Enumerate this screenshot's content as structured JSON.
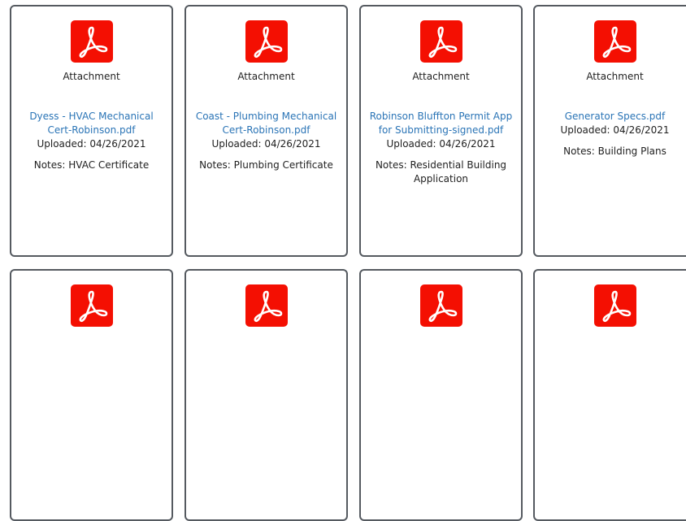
{
  "cards": [
    {
      "type_label": "Attachment",
      "file_name": "Dyess - HVAC Mechanical Cert-Robinson.pdf",
      "uploaded": "Uploaded: 04/26/2021",
      "notes": "Notes: HVAC Certificate",
      "icon": "pdf-icon"
    },
    {
      "type_label": "Attachment",
      "file_name": "Coast - Plumbing Mechanical Cert-Robinson.pdf",
      "uploaded": "Uploaded: 04/26/2021",
      "notes": "Notes: Plumbing Certificate",
      "icon": "pdf-icon"
    },
    {
      "type_label": "Attachment",
      "file_name": "Robinson Bluffton Permit App for Submitting-signed.pdf",
      "uploaded": "Uploaded: 04/26/2021",
      "notes": "Notes: Residential Building Application",
      "icon": "pdf-icon"
    },
    {
      "type_label": "Attachment",
      "file_name": "Generator Specs.pdf",
      "uploaded": "Uploaded: 04/26/2021",
      "notes": "Notes: Building Plans",
      "icon": "pdf-icon"
    },
    {
      "icon": "pdf-icon"
    },
    {
      "icon": "pdf-icon"
    },
    {
      "icon": "pdf-icon"
    },
    {
      "icon": "pdf-icon"
    }
  ],
  "colors": {
    "pdf_red": "#f40f02",
    "link_blue": "#2a74b6",
    "card_border": "#555a60"
  }
}
